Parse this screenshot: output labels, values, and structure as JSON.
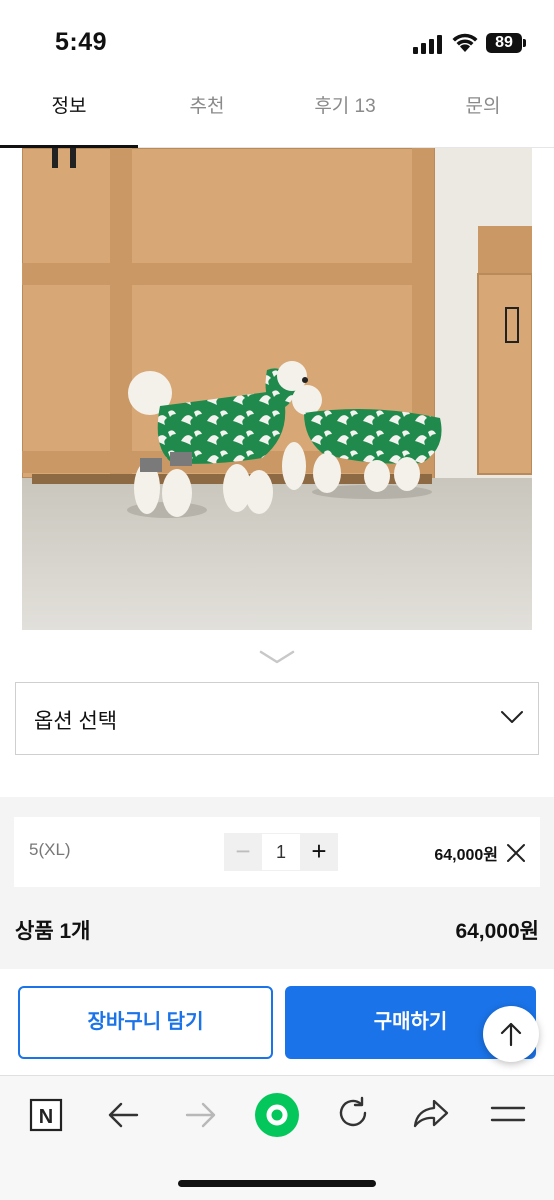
{
  "status_bar": {
    "time": "5:49",
    "battery": "89"
  },
  "tabs": [
    {
      "label": "정보",
      "active": true
    },
    {
      "label": "추천",
      "active": false
    },
    {
      "label": "후기 13",
      "active": false
    },
    {
      "label": "문의",
      "active": false
    }
  ],
  "option_select": {
    "label": "옵션 선택"
  },
  "selected_option": {
    "name": "5(XL)",
    "quantity": "1",
    "minus": "−",
    "plus": "+",
    "price": "64,000원"
  },
  "summary": {
    "label": "상품 1개",
    "total": "64,000원"
  },
  "actions": {
    "cart_label": "장바구니 담기",
    "buy_label": "구매하기"
  },
  "colors": {
    "accent": "#1a73e8",
    "naver_green": "#03c75a"
  },
  "browser_toolbar": {
    "icons": [
      "naver-n-icon",
      "back-arrow-icon",
      "forward-arrow-icon",
      "naver-green-dot-icon",
      "refresh-icon",
      "share-icon",
      "menu-icon"
    ],
    "n_glyph": "N"
  }
}
